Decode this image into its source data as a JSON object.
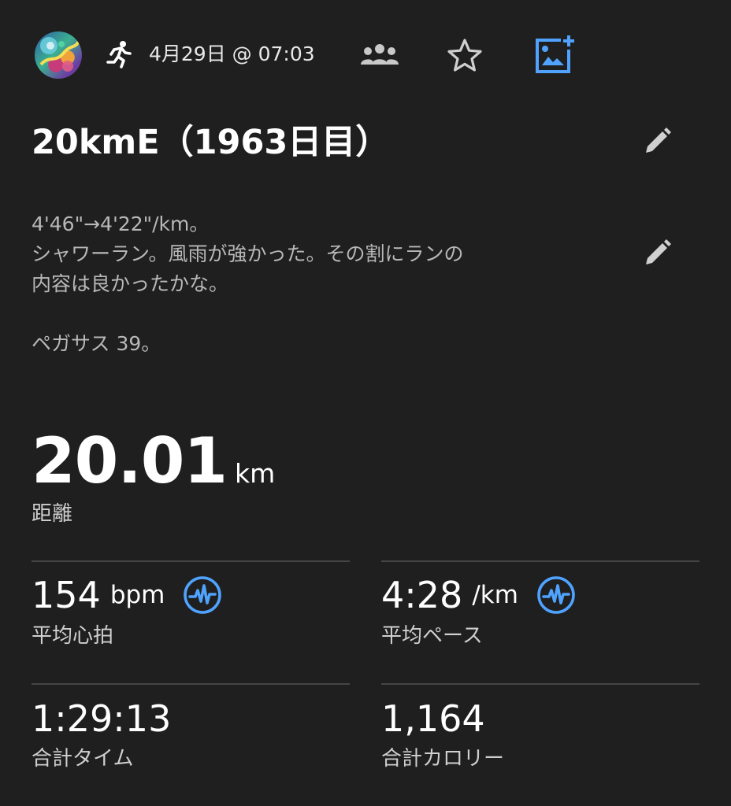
{
  "header": {
    "date": "4月29日 @ 07:03",
    "icons": [
      "avatar",
      "running-person-icon",
      "group-icon",
      "star-icon",
      "add-photo-icon"
    ],
    "accent_color": "#4fa3ff"
  },
  "activity": {
    "title": "20kmE（1963日目）",
    "description_lines": [
      "4'46\"→4'22\"/km。",
      "シャワーラン。風雨が強かった。その割にランの",
      "内容は良かったかな。",
      "",
      "ペガサス 39。"
    ]
  },
  "distance": {
    "value": "20.01",
    "unit": "km",
    "label": "距離"
  },
  "stats": {
    "heart_rate": {
      "value": "154",
      "unit": "bpm",
      "label": "平均心拍"
    },
    "pace": {
      "value": "4:28",
      "unit": "/km",
      "label": "平均ペース"
    },
    "time": {
      "value": "1:29:13",
      "label": "合計タイム"
    },
    "calories": {
      "value": "1,164",
      "label": "合計カロリー"
    }
  }
}
